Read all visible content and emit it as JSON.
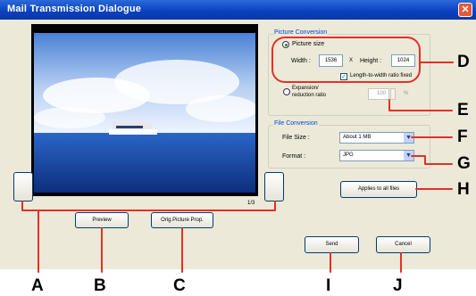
{
  "window": {
    "title": "Mail Transmission Dialogue",
    "close_glyph": "✕"
  },
  "preview_controls": {
    "page_counter": "1/3",
    "preview_label": "Preview",
    "orig_label": "Orig.Picture Prop."
  },
  "picture_conversion": {
    "title": "Picture Conversion",
    "size_label": "Picture size",
    "width_label": "Width :",
    "width_value": "1536",
    "x_label": "X",
    "height_label": "Height :",
    "height_value": "1024",
    "ratio_fixed_label": "Length-to-width ratio fixed",
    "expansion_label": "Expansion/\nreduction ratio",
    "ratio_value": "100",
    "percent_label": "%"
  },
  "file_conversion": {
    "title": "File Conversion",
    "size_label": "File Size :",
    "size_value": "About 1 MB",
    "format_label": "Format :",
    "format_value": "JPG"
  },
  "buttons": {
    "apply_all": "Applies to all files",
    "send": "Send",
    "cancel": "Cancel"
  },
  "callouts": {
    "a": "A",
    "b": "B",
    "c": "C",
    "d": "D",
    "e": "E",
    "f": "F",
    "g": "G",
    "h": "H",
    "i": "I",
    "j": "J"
  },
  "colors": {
    "callout_line": "#e53025",
    "title_bar": "#0a3fbf",
    "dialog_bg": "#ece9d8"
  }
}
